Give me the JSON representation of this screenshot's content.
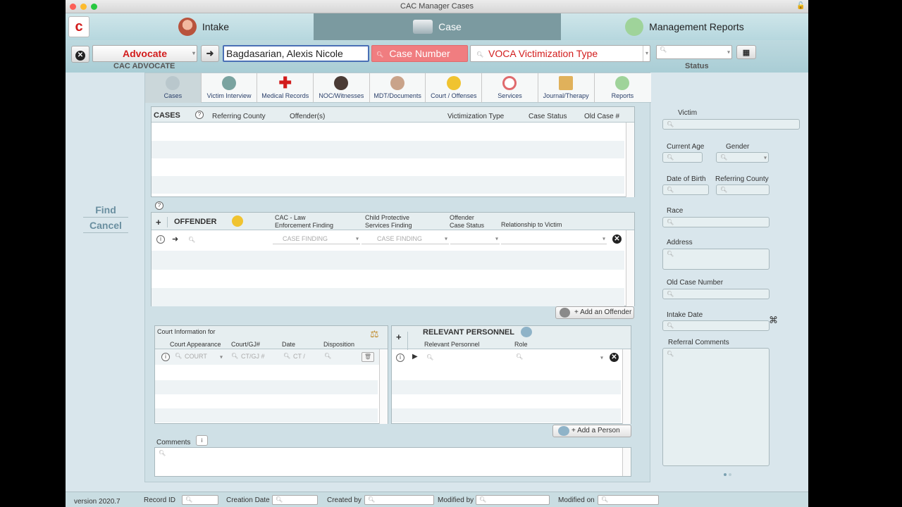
{
  "window": {
    "title": "CAC Manager Cases"
  },
  "nav": {
    "tabs": [
      {
        "label": "Intake"
      },
      {
        "label": "Case"
      },
      {
        "label": "Management Reports"
      }
    ]
  },
  "topbar": {
    "advocate_label": "Advocate",
    "name_value": "Bagdasarian, Alexis Nicole",
    "case_number_placeholder": "Case Number",
    "voca_placeholder": "VOCA Victimization Type",
    "cac_advocate_label": "CAC ADVOCATE",
    "status_label": "Status"
  },
  "tabs": [
    {
      "label": "Cases"
    },
    {
      "label": "Victim Interview"
    },
    {
      "label": "Medical Records"
    },
    {
      "label": "NOC/Witnesses"
    },
    {
      "label": "MDT/Documents"
    },
    {
      "label": "Court / Offenses"
    },
    {
      "label": "Services"
    },
    {
      "label": "Journal/Therapy"
    },
    {
      "label": "Reports"
    }
  ],
  "cases": {
    "title": "CASES",
    "columns": [
      "Referring County",
      "Offender(s)",
      "Victimization Type",
      "Case Status",
      "Old Case #"
    ]
  },
  "offender": {
    "title": "OFFENDER",
    "col_law": "CAC - Law\nEnforcement Finding",
    "col_law1": "CAC - Law",
    "col_law2": "Enforcement Finding",
    "col_cps1": "Child Protective",
    "col_cps2": "Services  Finding",
    "col_status1": "Offender",
    "col_status2": "Case Status",
    "col_relationship": "Relationship to Victim",
    "finding_placeholder": "CASE FINDING",
    "add_button": "+ Add an Offender"
  },
  "court": {
    "title": "Court Information for",
    "columns": [
      "Court Appearance",
      "Court/GJ#",
      "Date",
      "Disposition"
    ],
    "court_placeholder": "COURT",
    "ctgj_placeholder": "CT/GJ #",
    "date_placeholder": "CT /"
  },
  "personnel": {
    "title": "RELEVANT PERSONNEL",
    "columns": [
      "Relevant Personnel",
      "Role"
    ],
    "add_button": "+ Add a Person"
  },
  "comments": {
    "label": "Comments"
  },
  "side": {
    "find": "Find",
    "cancel": "Cancel"
  },
  "right": {
    "victim": "Victim",
    "current_age": "Current Age",
    "gender": "Gender",
    "dob": "Date of Birth",
    "referring_county": "Referring County",
    "race": "Race",
    "address": "Address",
    "old_case_number": "Old Case Number",
    "intake_date": "Intake Date",
    "referral_comments": "Referral Comments"
  },
  "footer": {
    "version": "version 2020.7",
    "record_id": "Record  ID",
    "creation_date": "Creation Date",
    "created_by": "Created by",
    "modified_by": "Modified by",
    "modified_on": "Modified on"
  },
  "colors": {
    "accent_red": "#d21c1c",
    "case_number_bg": "#f07d80",
    "nav_active": "#7b9aa0"
  }
}
